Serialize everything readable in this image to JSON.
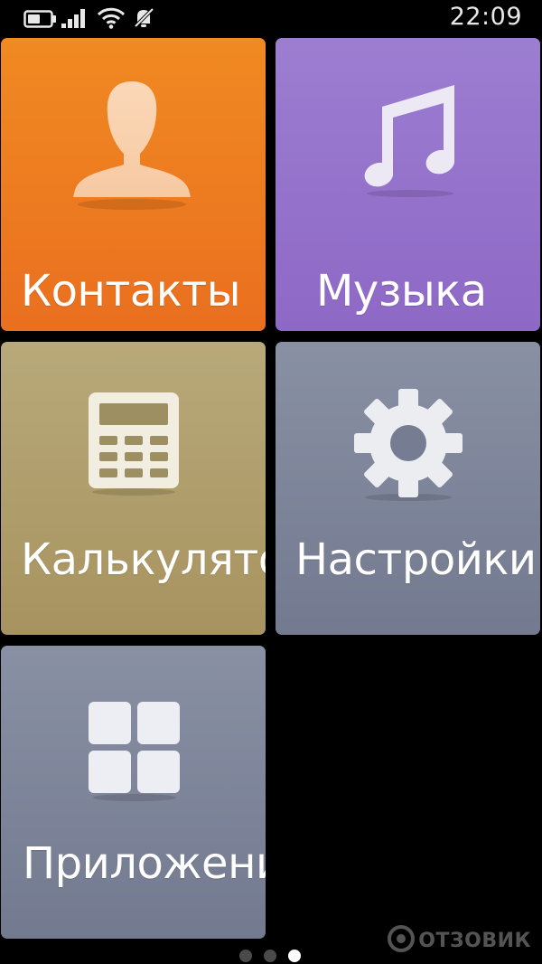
{
  "status_bar": {
    "time": "22:09",
    "icons": [
      "battery-icon",
      "signal-icon",
      "wifi-icon",
      "mute-icon"
    ]
  },
  "tiles": [
    {
      "id": "contacts",
      "label": "Контакты",
      "icon": "contact-person-icon",
      "color": "#ee7c20"
    },
    {
      "id": "music",
      "label": "Музыка",
      "icon": "music-note-icon",
      "color": "#9573cb"
    },
    {
      "id": "calculator",
      "label": "Калькулятор",
      "icon": "calculator-icon",
      "color": "#b09e6c"
    },
    {
      "id": "settings",
      "label": "Настройки",
      "icon": "gear-icon",
      "color": "#7e8599"
    },
    {
      "id": "apps",
      "label": "Приложения",
      "icon": "apps-grid-icon",
      "color": "#7e8599"
    }
  ],
  "page_indicator": {
    "total": 3,
    "current": 3
  },
  "watermark": {
    "text": "ОТЗОВИК"
  }
}
